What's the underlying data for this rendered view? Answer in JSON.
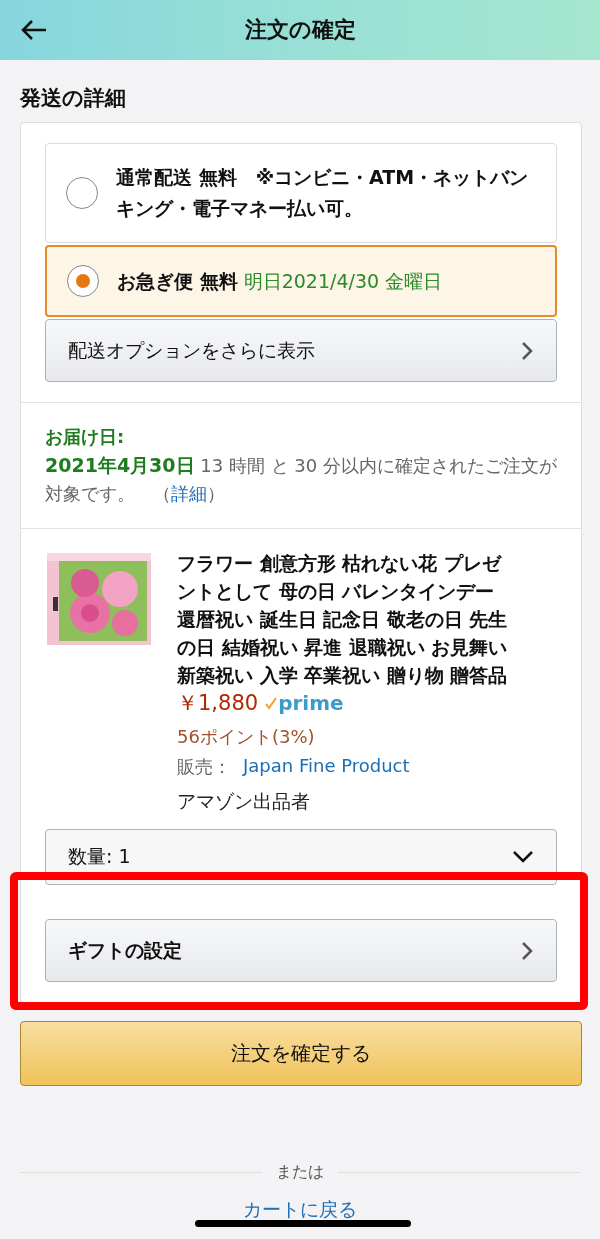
{
  "header": {
    "title": "注文の確定"
  },
  "section_title": "発送の詳細",
  "shipping_options": [
    {
      "name": "通常配送 無料",
      "note": "※コンビニ・ATM・ネットバンキング・電子マネー払い可。",
      "selected": false
    },
    {
      "name": "お急ぎ便 無料",
      "date": "明日2021/4/30 金曜日",
      "selected": true
    }
  ],
  "more_options": "配送オプションをさらに表示",
  "delivery": {
    "label": "お届け日:",
    "date": "2021年4月30日",
    "note": " 13 時間 と 30 分以内に確定されたご注文が対象です。　（",
    "link": "詳細",
    "close": "）"
  },
  "product": {
    "title": "フラワー 創意方形 枯れない花 プレゼントとして 母の日 バレンタインデー還暦祝い 誕生日 記念日 敬老の日 先生の日 結婚祝い 昇進 退職祝い お見舞い新築祝い 入学 卒業祝い 贈り物 贈答品",
    "price": "￥1,880",
    "prime": "prime",
    "points": "56ポイント(3%)",
    "seller_label": "販売：",
    "seller": "Japan Fine Product",
    "seller_type": "アマゾン出品者"
  },
  "quantity": "数量: 1",
  "gift_settings": "ギフトの設定",
  "confirm_button": "注文を確定する",
  "divider_text": "または",
  "cart_link": "カートに戻る"
}
